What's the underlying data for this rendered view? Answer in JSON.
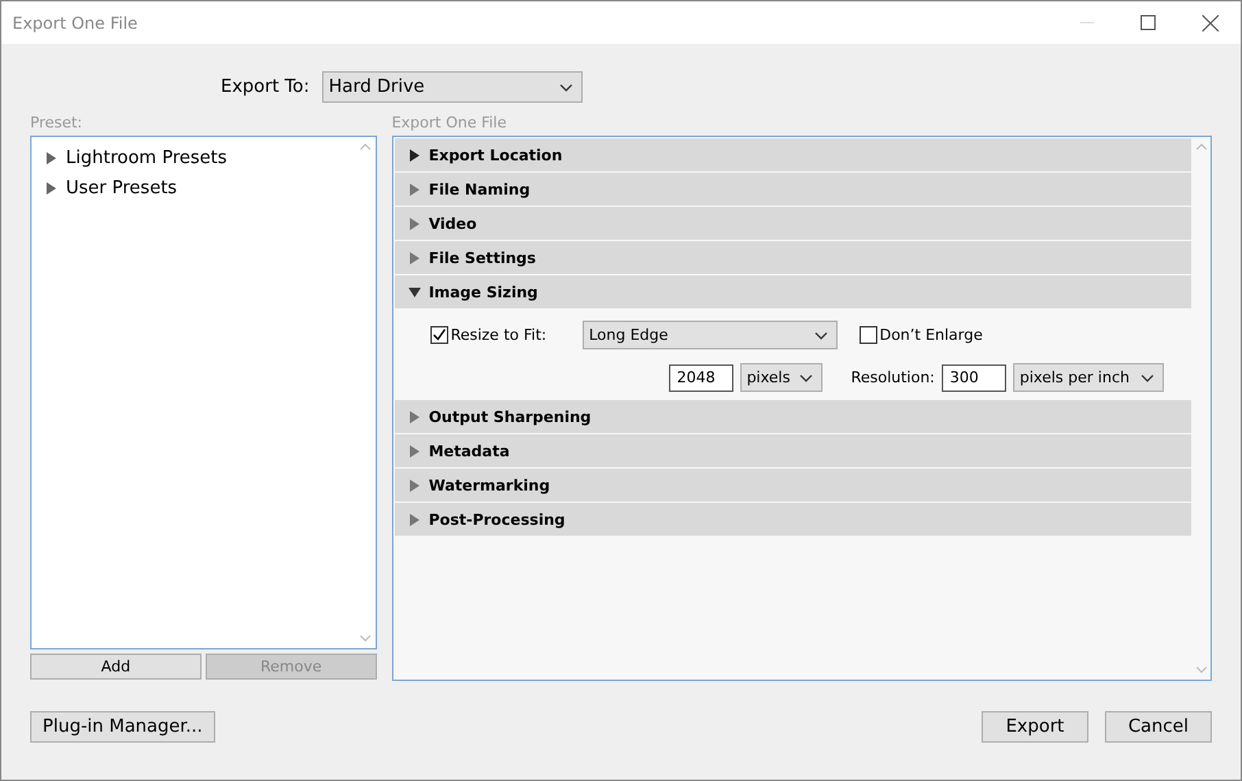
{
  "window": {
    "title": "Export One File"
  },
  "export_to": {
    "label": "Export To:",
    "value": "Hard Drive"
  },
  "preset": {
    "label": "Preset:",
    "items": [
      {
        "label": "Lightroom Presets",
        "expanded": false
      },
      {
        "label": "User Presets",
        "expanded": false
      }
    ],
    "buttons": [
      {
        "label": "Add",
        "disabled": false
      },
      {
        "label": "Remove",
        "disabled": true
      }
    ]
  },
  "export_panel": {
    "label": "Export One File",
    "sections": [
      {
        "title": "Export Location",
        "expanded": false
      },
      {
        "title": "File Naming",
        "expanded": false
      },
      {
        "title": "Video",
        "expanded": false
      },
      {
        "title": "File Settings",
        "expanded": false
      },
      {
        "title": "Image Sizing",
        "expanded": true,
        "content": {
          "resize_to_fit": {
            "label": "Resize to Fit:",
            "checked": true
          },
          "fit_mode": "Long Edge",
          "dont_enlarge": {
            "label": "Don’t Enlarge",
            "checked": false
          },
          "size": "2048",
          "size_unit": "pixels",
          "resolution_label": "Resolution:",
          "resolution": "300",
          "resolution_unit": "pixels per inch"
        }
      },
      {
        "title": "Output Sharpening",
        "expanded": false
      },
      {
        "title": "Metadata",
        "expanded": false
      },
      {
        "title": "Watermarking",
        "expanded": false
      },
      {
        "title": "Post-Processing",
        "expanded": false
      }
    ]
  },
  "footer": {
    "plugin_button": "Plug-in Manager...",
    "buttons": [
      "Export",
      "Cancel"
    ]
  }
}
